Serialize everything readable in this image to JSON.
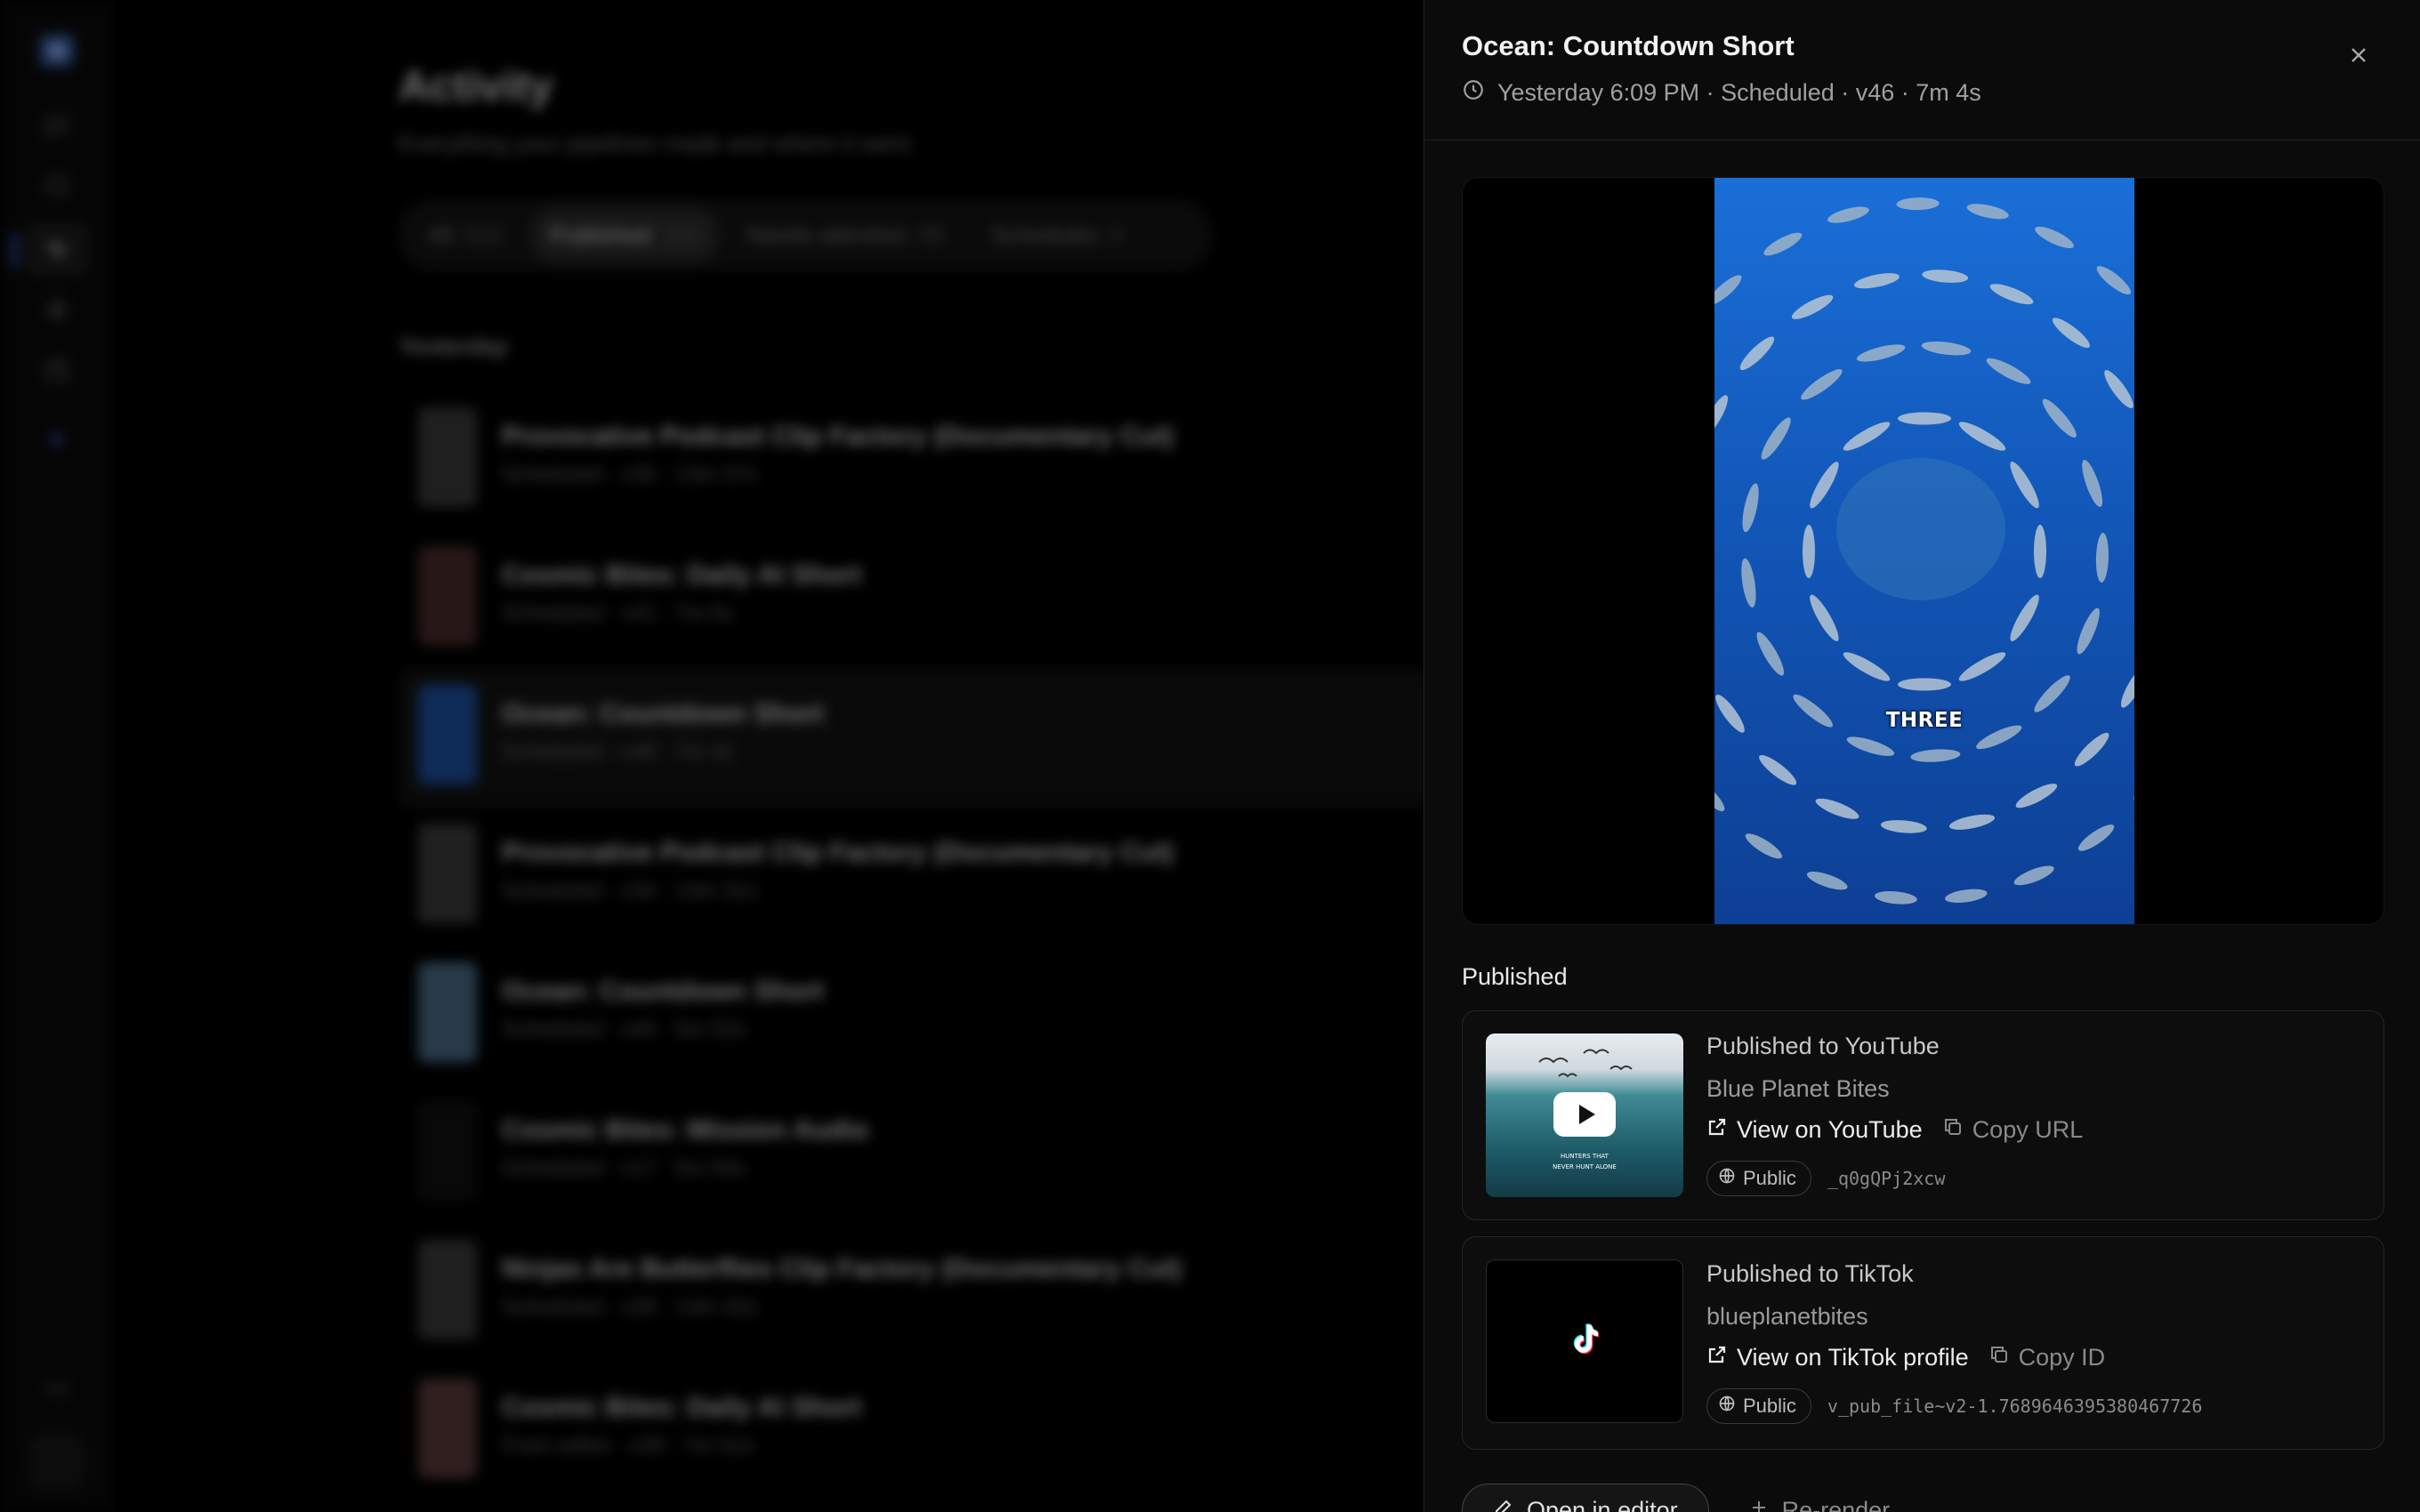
{
  "background": {
    "page_title": "Activity",
    "page_subtitle": "Everything your pipelines made and where it went.",
    "tabs": [
      {
        "label": "All",
        "count": "515"
      },
      {
        "label": "Published",
        "count": "150"
      },
      {
        "label": "Needs attention",
        "count": "95"
      },
      {
        "label": "Schedules",
        "count": "4"
      }
    ],
    "section_label": "Yesterday",
    "items": [
      {
        "title": "Provocative Podcast Clip Factory (Documentary Cut)",
        "meta": "Scheduled · v35 · 13m 37s",
        "thumb": "#3a3a3a"
      },
      {
        "title": "Cosmic Bites: Daily AI Short",
        "meta": "Scheduled · v41 · 7m 6s",
        "thumb": "#4a2b2b"
      },
      {
        "title": "Ocean: Countdown Short",
        "meta": "Scheduled · v46 · 7m 4s",
        "thumb": "#1d4f9e"
      },
      {
        "title": "Provocative Podcast Clip Factory (Documentary Cut)",
        "meta": "Scheduled · v34 · 14m 31s",
        "thumb": "#3b3b3b"
      },
      {
        "title": "Ocean: Countdown Short",
        "meta": "Scheduled · v45 · 5m 52s",
        "thumb": "#4b6a86"
      },
      {
        "title": "Cosmic Bites: Mission Audio",
        "meta": "Scheduled · v17 · 5m 54s",
        "thumb": "#111111"
      },
      {
        "title": "Ninjas Are Butterflies Clip Factory (Documentary Cut)",
        "meta": "Scheduled · v28 · 14m 42s",
        "thumb": "#3a3a3a"
      },
      {
        "title": "Cosmic Bites: Daily AI Short",
        "meta": "From editor · v39 · 7m 51s",
        "thumb": "#5a3a3a"
      }
    ]
  },
  "drawer": {
    "title": "Ocean: Countdown Short",
    "meta": "Yesterday 6:09 PM · Scheduled · v46 · 7m 4s",
    "video_caption": "THREE",
    "published_label": "Published",
    "youtube": {
      "heading": "Published to YouTube",
      "account": "Blue Planet Bites",
      "view_label": "View on YouTube",
      "copy_label": "Copy URL",
      "visibility": "Public",
      "id": "_q0gQPj2xcw",
      "thumb_text_1": "HUNTERS THAT",
      "thumb_text_2": "NEVER HUNT ALONE"
    },
    "tiktok": {
      "heading": "Published to TikTok",
      "account": "blueplanetbites",
      "view_label": "View on TikTok profile",
      "copy_label": "Copy ID",
      "visibility": "Public",
      "id": "v_pub_file~v2-1.7689646395380467726"
    },
    "open_in_editor_label": "Open in editor",
    "re_render_label": "Re-render"
  },
  "colors": {
    "accent": "#3a6be0",
    "video_blue": "#1a6fd8"
  }
}
